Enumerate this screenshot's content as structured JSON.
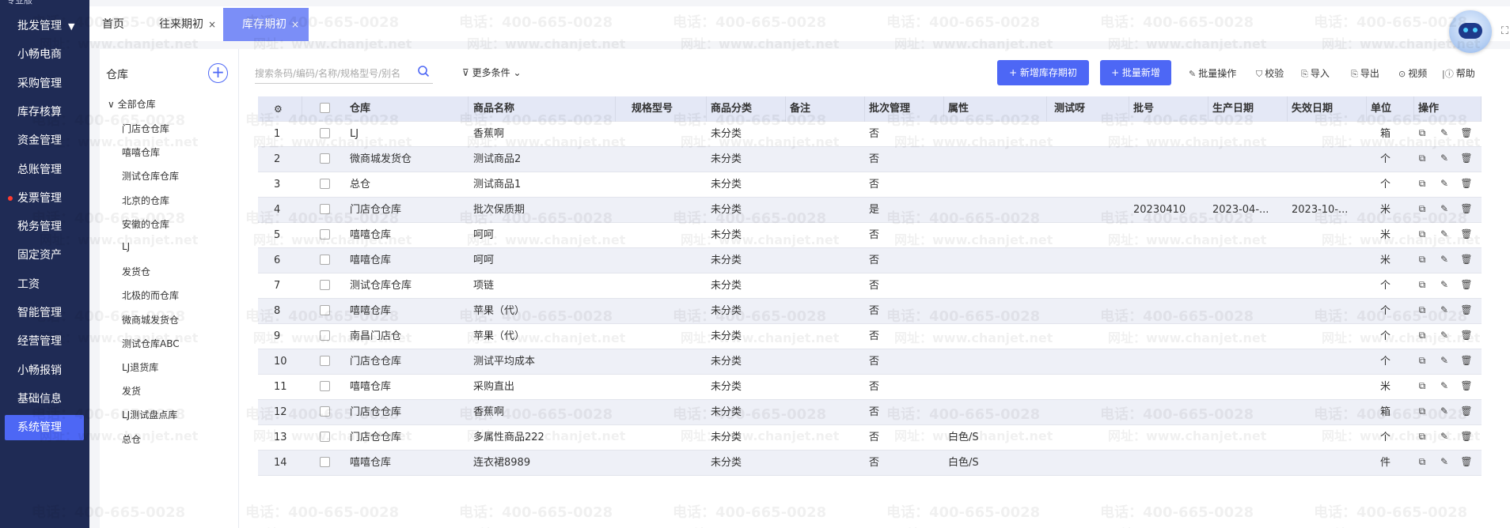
{
  "nav": {
    "edition": "专业版",
    "items": [
      {
        "label": "批发管理",
        "caret": "▼"
      },
      {
        "label": "小畅电商"
      },
      {
        "label": "采购管理"
      },
      {
        "label": "库存核算"
      },
      {
        "label": "资金管理"
      },
      {
        "label": "总账管理"
      },
      {
        "label": "发票管理"
      },
      {
        "label": "税务管理"
      },
      {
        "label": "固定资产"
      },
      {
        "label": "工资"
      },
      {
        "label": "智能管理"
      },
      {
        "label": "经营管理"
      },
      {
        "label": "小畅报销"
      },
      {
        "label": "基础信息"
      },
      {
        "label": "系统管理"
      }
    ]
  },
  "tabs": [
    {
      "label": "首页",
      "close": ""
    },
    {
      "label": "往来期初",
      "close": "×"
    },
    {
      "label": "库存期初",
      "close": "×"
    }
  ],
  "top_right_glyph": "⛶",
  "panel": {
    "title": "仓库",
    "add_glyph": "+",
    "root": "∨  全部仓库",
    "items": [
      "门店仓仓库",
      "嘻嘻仓库",
      "测试仓库仓库",
      "北京的仓库",
      "安徽的仓库",
      "LJ",
      "发货仓",
      "北极的而仓库",
      "微商城发货仓",
      "测试仓库ABC",
      "LJ退货库",
      "发货",
      "LJ测试盘点库",
      "总仓"
    ]
  },
  "toolbar": {
    "search_placeholder": "搜索条码/编码/名称/规格型号/别名",
    "more_label": "更多条件",
    "new_btn": "+ 新增库存期初",
    "batch_new_btn": "+ 批量新增",
    "batch_op": "批量操作",
    "verify": "校验",
    "import": "导入",
    "export": "导出",
    "video": "视频",
    "help": "帮助"
  },
  "table": {
    "columns": [
      "仓库",
      "商品名称",
      "规格型号",
      "商品分类",
      "备注",
      "批次管理",
      "属性",
      "测试呀",
      "批号",
      "生产日期",
      "失效日期",
      "单位",
      "操作"
    ],
    "rows": [
      {
        "no": "1",
        "wh": "LJ",
        "name": "香蕉啊",
        "cat": "未分类",
        "batch": "否",
        "attr": "",
        "lot": "",
        "mfg": "",
        "exp": "",
        "unit": "箱"
      },
      {
        "no": "2",
        "wh": "微商城发货仓",
        "name": "测试商品2",
        "cat": "未分类",
        "batch": "否",
        "attr": "",
        "lot": "",
        "mfg": "",
        "exp": "",
        "unit": "个"
      },
      {
        "no": "3",
        "wh": "总仓",
        "name": "测试商品1",
        "cat": "未分类",
        "batch": "否",
        "attr": "",
        "lot": "",
        "mfg": "",
        "exp": "",
        "unit": "个"
      },
      {
        "no": "4",
        "wh": "门店仓仓库",
        "name": "批次保质期",
        "cat": "未分类",
        "batch": "是",
        "attr": "",
        "lot": "20230410",
        "mfg": "2023-04-...",
        "exp": "2023-10-...",
        "unit": "米"
      },
      {
        "no": "5",
        "wh": "嘻嘻仓库",
        "name": "呵呵",
        "cat": "未分类",
        "batch": "否",
        "attr": "",
        "lot": "",
        "mfg": "",
        "exp": "",
        "unit": "米"
      },
      {
        "no": "6",
        "wh": "嘻嘻仓库",
        "name": "呵呵",
        "cat": "未分类",
        "batch": "否",
        "attr": "",
        "lot": "",
        "mfg": "",
        "exp": "",
        "unit": "米"
      },
      {
        "no": "7",
        "wh": "测试仓库仓库",
        "name": "项链",
        "cat": "未分类",
        "batch": "否",
        "attr": "",
        "lot": "",
        "mfg": "",
        "exp": "",
        "unit": "个"
      },
      {
        "no": "8",
        "wh": "嘻嘻仓库",
        "name": "苹果（代）",
        "cat": "未分类",
        "batch": "否",
        "attr": "",
        "lot": "",
        "mfg": "",
        "exp": "",
        "unit": "个"
      },
      {
        "no": "9",
        "wh": "南昌门店仓",
        "name": "苹果（代）",
        "cat": "未分类",
        "batch": "否",
        "attr": "",
        "lot": "",
        "mfg": "",
        "exp": "",
        "unit": "个"
      },
      {
        "no": "10",
        "wh": "门店仓仓库",
        "name": "测试平均成本",
        "cat": "未分类",
        "batch": "否",
        "attr": "",
        "lot": "",
        "mfg": "",
        "exp": "",
        "unit": "个"
      },
      {
        "no": "11",
        "wh": "嘻嘻仓库",
        "name": "采购直出",
        "cat": "未分类",
        "batch": "否",
        "attr": "",
        "lot": "",
        "mfg": "",
        "exp": "",
        "unit": "米"
      },
      {
        "no": "12",
        "wh": "门店仓仓库",
        "name": "香蕉啊",
        "cat": "未分类",
        "batch": "否",
        "attr": "",
        "lot": "",
        "mfg": "",
        "exp": "",
        "unit": "箱"
      },
      {
        "no": "13",
        "wh": "门店仓仓库",
        "name": "多属性商品222",
        "cat": "未分类",
        "batch": "否",
        "attr": "白色/S",
        "lot": "",
        "mfg": "",
        "exp": "",
        "unit": "个"
      },
      {
        "no": "14",
        "wh": "嘻嘻仓库",
        "name": "连衣裙8989",
        "cat": "未分类",
        "batch": "否",
        "attr": "白色/S",
        "lot": "",
        "mfg": "",
        "exp": "",
        "unit": "件"
      }
    ]
  },
  "watermark": {
    "phone": "电话：400-665-0028",
    "site": "网址：www.chanjet.net"
  },
  "colors": {
    "nav_bg": "#1f2b55",
    "accent": "#4d67f5",
    "tab_active": "#7b8ef7"
  }
}
